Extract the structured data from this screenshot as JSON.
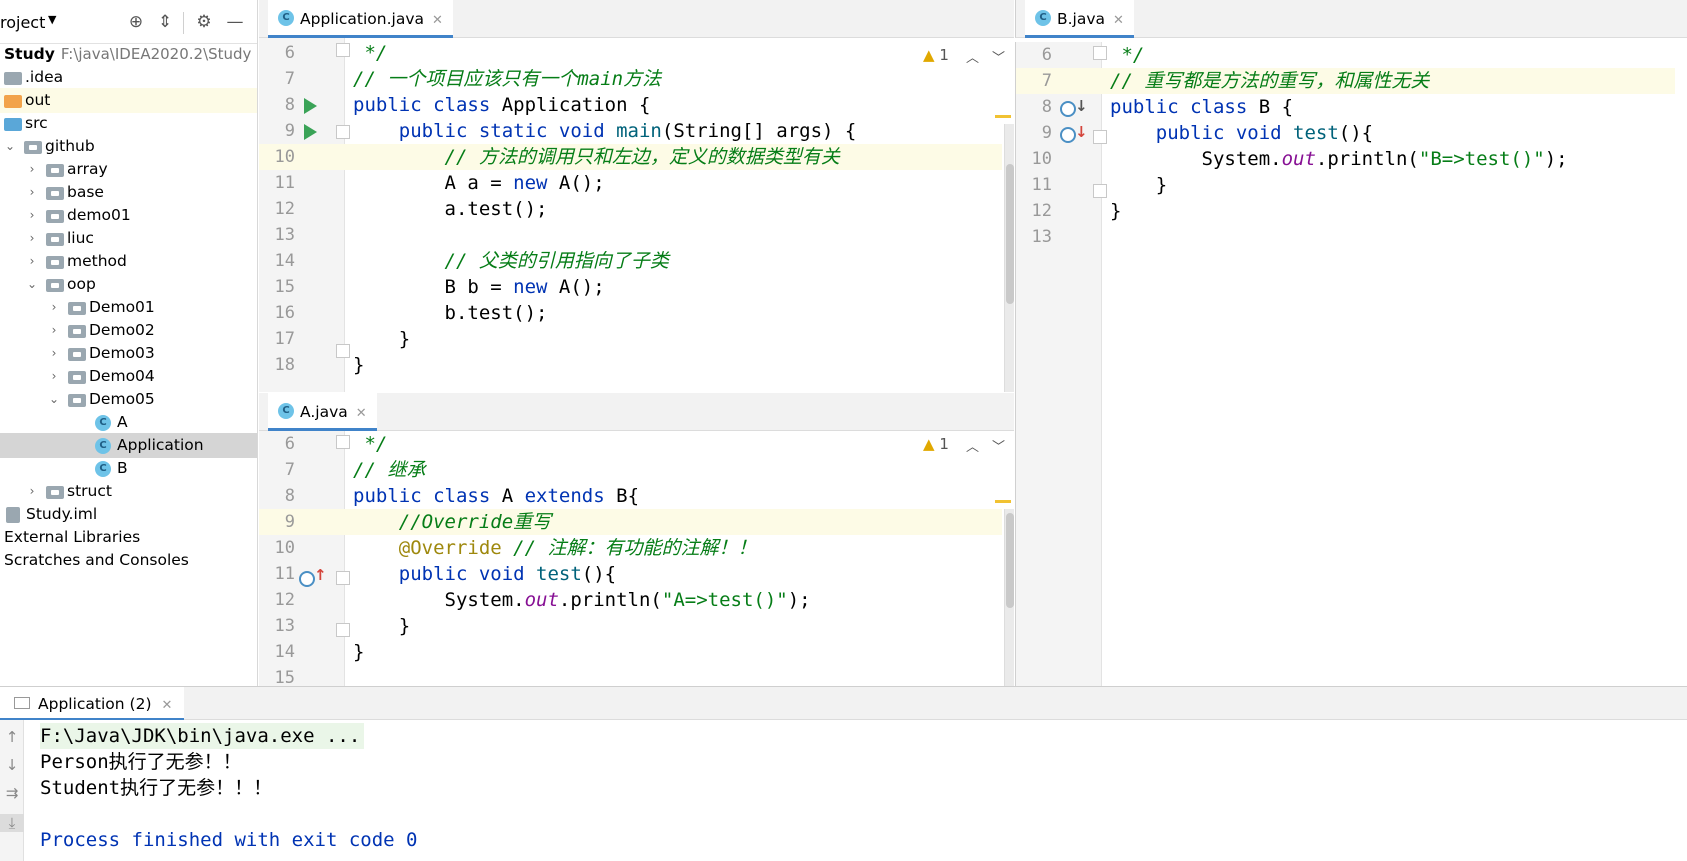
{
  "project": {
    "title": "roject",
    "root_name": "Study",
    "root_path": "F:\\java\\IDEA2020.2\\Study",
    "tree": [
      {
        "label": ".idea"
      },
      {
        "label": "out"
      },
      {
        "label": "src"
      },
      {
        "label": "github"
      },
      {
        "label": "array"
      },
      {
        "label": "base"
      },
      {
        "label": "demo01"
      },
      {
        "label": "liuc"
      },
      {
        "label": "method"
      },
      {
        "label": "oop"
      },
      {
        "label": "Demo01"
      },
      {
        "label": "Demo02"
      },
      {
        "label": "Demo03"
      },
      {
        "label": "Demo04"
      },
      {
        "label": "Demo05"
      },
      {
        "label": "A"
      },
      {
        "label": "Application"
      },
      {
        "label": "B"
      },
      {
        "label": "struct"
      },
      {
        "label": "Study.iml"
      },
      {
        "label": "External Libraries"
      },
      {
        "label": "Scratches and Consoles"
      }
    ]
  },
  "editors": {
    "application": {
      "tab": "Application.java",
      "warning_count": "1",
      "lines": [
        {
          "n": "6",
          "segs": [
            {
              "t": " */",
              "c": "cm-green"
            }
          ]
        },
        {
          "n": "7",
          "segs": [
            {
              "t": "// 一个项目应该只有一个main方法",
              "c": "cm-green"
            }
          ]
        },
        {
          "n": "8",
          "segs": [
            {
              "t": "public class ",
              "c": "kw"
            },
            {
              "t": "Application {",
              "c": ""
            }
          ]
        },
        {
          "n": "9",
          "segs": [
            {
              "t": "    public static void ",
              "c": "kw"
            },
            {
              "t": "main",
              "c": "fn"
            },
            {
              "t": "(String[] args) {",
              "c": ""
            }
          ]
        },
        {
          "n": "10",
          "segs": [
            {
              "t": "        // 方法的调用只和左边，定义的数据类型有关",
              "c": "cm-green"
            }
          ]
        },
        {
          "n": "11",
          "segs": [
            {
              "t": "        A a = ",
              "c": ""
            },
            {
              "t": "new ",
              "c": "kw"
            },
            {
              "t": "A();",
              "c": ""
            }
          ]
        },
        {
          "n": "12",
          "segs": [
            {
              "t": "        a.test();",
              "c": ""
            }
          ]
        },
        {
          "n": "13",
          "segs": []
        },
        {
          "n": "14",
          "segs": [
            {
              "t": "        // 父类的引用指向了子类",
              "c": "cm-green"
            }
          ]
        },
        {
          "n": "15",
          "segs": [
            {
              "t": "        B b = ",
              "c": ""
            },
            {
              "t": "new ",
              "c": "kw"
            },
            {
              "t": "A();",
              "c": ""
            }
          ]
        },
        {
          "n": "16",
          "segs": [
            {
              "t": "        b.test();",
              "c": ""
            }
          ]
        },
        {
          "n": "17",
          "segs": [
            {
              "t": "    }",
              "c": ""
            }
          ]
        },
        {
          "n": "18",
          "segs": [
            {
              "t": "}",
              "c": ""
            }
          ]
        }
      ]
    },
    "a": {
      "tab": "A.java",
      "warning_count": "1",
      "lines": [
        {
          "n": "6",
          "segs": [
            {
              "t": " */",
              "c": "cm-green"
            }
          ]
        },
        {
          "n": "7",
          "segs": [
            {
              "t": "// 继承",
              "c": "cm-green"
            }
          ]
        },
        {
          "n": "8",
          "segs": [
            {
              "t": "public class ",
              "c": "kw"
            },
            {
              "t": "A ",
              "c": ""
            },
            {
              "t": "extends ",
              "c": "kw"
            },
            {
              "t": "B{",
              "c": ""
            }
          ]
        },
        {
          "n": "9",
          "segs": [
            {
              "t": "    //Override重写",
              "c": "cm-green"
            }
          ]
        },
        {
          "n": "10",
          "segs": [
            {
              "t": "    @Override ",
              "c": "ann"
            },
            {
              "t": "// 注解：有功能的注解！！",
              "c": "cm-green"
            }
          ]
        },
        {
          "n": "11",
          "segs": [
            {
              "t": "    public void ",
              "c": "kw"
            },
            {
              "t": "test",
              "c": "fn"
            },
            {
              "t": "(){",
              "c": ""
            }
          ]
        },
        {
          "n": "12",
          "segs": [
            {
              "t": "        System.",
              "c": ""
            },
            {
              "t": "out",
              "c": "field"
            },
            {
              "t": ".println(",
              "c": ""
            },
            {
              "t": "\"A=>test()\"",
              "c": "str"
            },
            {
              "t": ");",
              "c": ""
            }
          ]
        },
        {
          "n": "13",
          "segs": [
            {
              "t": "    }",
              "c": ""
            }
          ]
        },
        {
          "n": "14",
          "segs": [
            {
              "t": "}",
              "c": ""
            }
          ]
        },
        {
          "n": "15",
          "segs": []
        }
      ]
    },
    "b": {
      "tab": "B.java",
      "lines": [
        {
          "n": "6",
          "segs": [
            {
              "t": " */",
              "c": "cm-green"
            }
          ]
        },
        {
          "n": "7",
          "segs": [
            {
              "t": "// 重写都是方法的重写，和属性无关",
              "c": "cm-green"
            }
          ]
        },
        {
          "n": "8",
          "segs": [
            {
              "t": "public class ",
              "c": "kw"
            },
            {
              "t": "B {",
              "c": ""
            }
          ]
        },
        {
          "n": "9",
          "segs": [
            {
              "t": "    public void ",
              "c": "kw"
            },
            {
              "t": "test",
              "c": "fn"
            },
            {
              "t": "(){",
              "c": ""
            }
          ]
        },
        {
          "n": "10",
          "segs": [
            {
              "t": "        System.",
              "c": ""
            },
            {
              "t": "out",
              "c": "field"
            },
            {
              "t": ".println(",
              "c": ""
            },
            {
              "t": "\"B=>test()\"",
              "c": "str"
            },
            {
              "t": ");",
              "c": ""
            }
          ]
        },
        {
          "n": "11",
          "segs": [
            {
              "t": "    }",
              "c": ""
            }
          ]
        },
        {
          "n": "12",
          "segs": [
            {
              "t": "}",
              "c": ""
            }
          ]
        },
        {
          "n": "13",
          "segs": []
        }
      ]
    }
  },
  "run": {
    "tab": "Application (2)",
    "console": [
      "F:\\Java\\JDK\\bin\\java.exe ...",
      "Person执行了无参！！",
      "Student执行了无参！！！",
      "",
      "Process finished with exit code 0"
    ]
  },
  "colors": {
    "keyword": "#0033b3",
    "comment": "#067d17",
    "string": "#067d17",
    "annotation": "#9e880d",
    "static_field": "#871094",
    "highlight_line": "#fdfbe6",
    "selection": "#d5d5d5",
    "tab_underline": "#4083c9"
  },
  "icons": {
    "project_toolbar": [
      "crosshair-icon",
      "collapse-icon",
      "gear-icon",
      "minimize-icon"
    ],
    "run_sidebar": [
      "arrow-up-icon",
      "arrow-down-icon",
      "soft-wrap-icon",
      "scroll-to-end-icon"
    ]
  }
}
